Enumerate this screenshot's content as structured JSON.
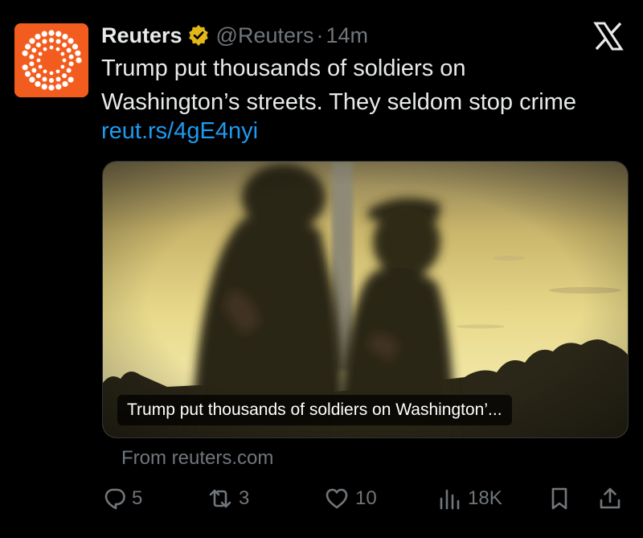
{
  "tweet": {
    "author_name": "Reuters",
    "handle": "@Reuters",
    "separator": "·",
    "time": "14m",
    "text_lines": [
      "Trump put thousands of soldiers on",
      "Washington’s streets. They seldom stop crime"
    ],
    "link": "reut.rs/4gE4nyi"
  },
  "card": {
    "caption": "Trump put thousands of soldiers on Washington’...",
    "source": "From reuters.com"
  },
  "actions": {
    "replies": "5",
    "reposts": "3",
    "likes": "10",
    "views": "18K"
  },
  "colors": {
    "background": "#000000",
    "text": "#e7e9ea",
    "muted": "#71767b",
    "link": "#1d9bf0",
    "brand_orange": "#f25d1f",
    "verified_gold": "#e2b719"
  },
  "icons": {
    "avatar": "reuters-logo-icon",
    "verified": "verified-badge-icon",
    "platform": "x-logo-icon",
    "reply": "reply-icon",
    "repost": "repost-icon",
    "like": "heart-icon",
    "views": "views-icon",
    "bookmark": "bookmark-icon",
    "share": "share-icon"
  }
}
